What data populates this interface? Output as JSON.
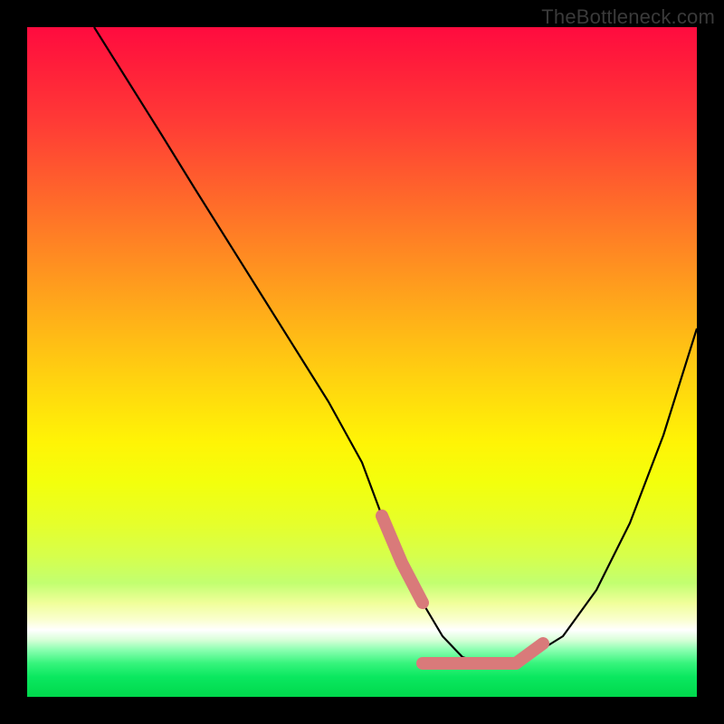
{
  "watermark": "TheBottleneck.com",
  "chart_data": {
    "type": "line",
    "title": "",
    "xlabel": "",
    "ylabel": "",
    "xlim": [
      0,
      100
    ],
    "ylim": [
      0,
      100
    ],
    "series": [
      {
        "name": "main-curve",
        "x": [
          10,
          15,
          20,
          25,
          30,
          35,
          40,
          45,
          50,
          53,
          56,
          59,
          62,
          65,
          68,
          71,
          75,
          80,
          85,
          90,
          95,
          100
        ],
        "values": [
          100,
          92,
          84,
          76,
          68,
          60,
          52,
          44,
          35,
          27,
          20,
          14,
          9,
          6,
          5,
          5,
          6,
          9,
          16,
          26,
          39,
          55
        ]
      }
    ],
    "highlight_segments": [
      {
        "name": "left-shoulder",
        "x": [
          53,
          59
        ],
        "values": [
          27,
          14
        ]
      },
      {
        "name": "trough",
        "x": [
          59,
          73
        ],
        "values": [
          5,
          5
        ]
      },
      {
        "name": "right-shoulder",
        "x": [
          73,
          77
        ],
        "values": [
          5,
          8
        ]
      }
    ],
    "colors": {
      "curve": "#000000",
      "highlight": "#d97a7a"
    }
  }
}
